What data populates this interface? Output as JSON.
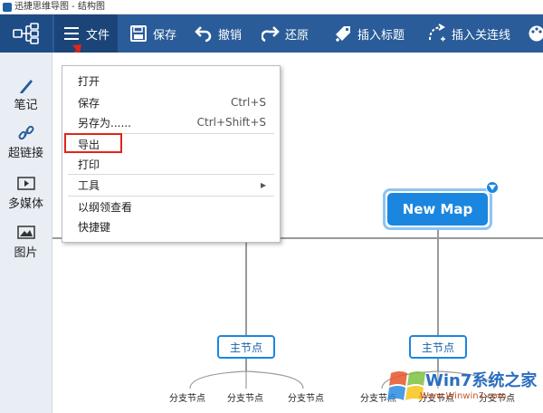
{
  "window": {
    "title": "迅捷思维导图 - 结构图"
  },
  "toolbar": {
    "file": "文件",
    "save": "保存",
    "undo": "撤销",
    "redo": "还原",
    "insert_topic": "插入标题",
    "insert_relation": "插入关连线"
  },
  "sidebar": {
    "items": [
      {
        "label": "笔记",
        "icon": "pencil-icon"
      },
      {
        "label": "超链接",
        "icon": "link-icon"
      },
      {
        "label": "多媒体",
        "icon": "media-icon"
      },
      {
        "label": "图片",
        "icon": "image-icon"
      }
    ]
  },
  "menu": {
    "items": [
      {
        "label": "打开",
        "shortcut": ""
      },
      {
        "label": "保存",
        "shortcut": "Ctrl+S"
      },
      {
        "label": "另存为......",
        "shortcut": "Ctrl+Shift+S"
      },
      {
        "label": "导出",
        "shortcut": ""
      },
      {
        "label": "打印",
        "shortcut": ""
      },
      {
        "label": "工具",
        "shortcut": "▸"
      },
      {
        "label": "以纲领查看",
        "shortcut": ""
      },
      {
        "label": "快捷键",
        "shortcut": ""
      }
    ],
    "highlighted_item": "导出"
  },
  "mindmap": {
    "root": "New Map",
    "main_nodes": [
      {
        "label": "主节点",
        "children": [
          "分支节点",
          "分支节点",
          "分支节点"
        ]
      },
      {
        "label": "主节点",
        "children": [
          "分支节点",
          "分支节点",
          "分支节点"
        ]
      }
    ]
  },
  "watermark": {
    "brand": "Win7系统之家",
    "url": "Www.Winwin7.com"
  },
  "colors": {
    "toolbar_bg": "#2a5c99",
    "sidebar_bg": "#e9eef5",
    "root_node": "#1b86e0",
    "highlight": "#e0251b",
    "connector": "#9a9a9a"
  }
}
